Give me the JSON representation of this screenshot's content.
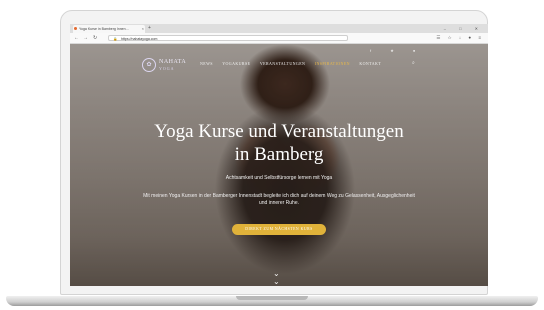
{
  "browser": {
    "tab_title": "Yoga Kurse in Bamberg Innenstadt - Nahata Yoga - Mozilla Firefox",
    "tab_short": "Yoga Kurse in Bamberg Innen…",
    "url": "https://nahatayoga.com",
    "new_tab_symbol": "+",
    "window_controls": "– □ ✕",
    "nav_back": "←",
    "nav_forward": "→",
    "nav_reload": "↻",
    "toolbar_icons": "☰ ☆ ↓ ● ≡"
  },
  "site": {
    "logo_name": "NAHATA",
    "logo_sub": "YOGA",
    "menu": [
      {
        "label": "NEWS",
        "active": false
      },
      {
        "label": "YOGAKURSE",
        "active": false
      },
      {
        "label": "VERANSTALTUNGEN",
        "active": false
      },
      {
        "label": "INSPIRATIONEN",
        "active": true
      },
      {
        "label": "KONTAKT",
        "active": false
      }
    ],
    "social": "f ★ ●",
    "hero_title_line1": "Yoga Kurse und Veranstaltungen",
    "hero_title_line2": "in Bamberg",
    "hero_subtitle": "Achtsamkeit und Selbstfürsorge lernen mit Yoga",
    "hero_text": "Mit meinen Yoga Kursen in der Bamberger Innenstadt begleite ich dich auf deinem Weg zu Gelassenheit, Ausgeglichenheit und innerer Ruhe.",
    "cta_label": "DIREKT ZUM NÄCHSTEN KURS",
    "accent_color": "#e0b23a"
  }
}
